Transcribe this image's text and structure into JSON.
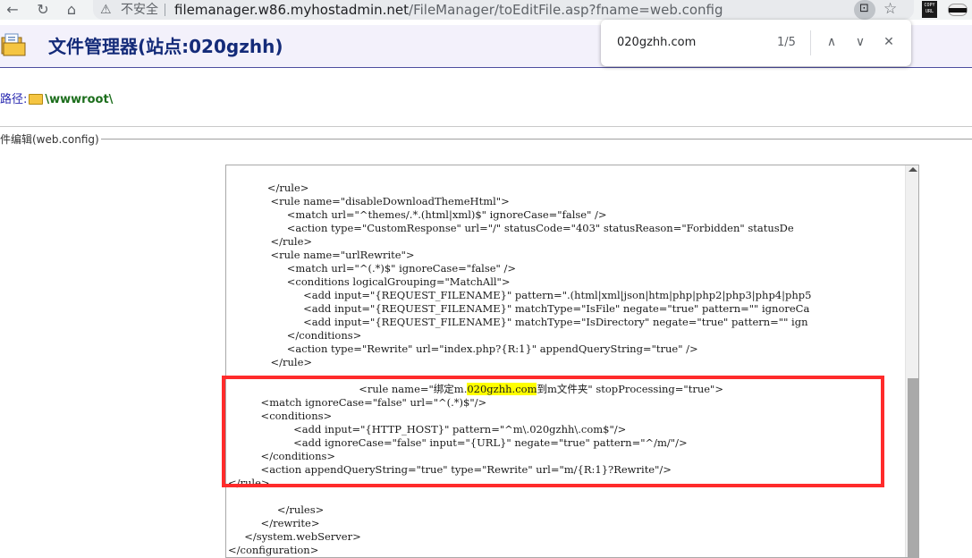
{
  "browser": {
    "back_icon": "arrow-left",
    "forward_icon": "arrow-right",
    "reload_icon": "reload",
    "home_icon": "home",
    "security_label": "不安全",
    "url_host": "filemanager.w86.myhostadmin.net",
    "url_path": "/FileManager/toEditFile.asp?fname=web.config",
    "extensions": [
      "copy-url",
      "mask"
    ]
  },
  "header": {
    "title": "文件管理器(站点:020gzhh)"
  },
  "find": {
    "query": "020gzhh.com",
    "count": "1/5"
  },
  "path": {
    "label": "路径:",
    "value": "\\wwwroot\\"
  },
  "fieldset": {
    "legend": "件编辑(web.config)"
  },
  "editor": {
    "scroll_position": 0.55,
    "lines": [
      "            </rule>",
      "             <rule name=\"disableDownloadThemeHtml\">",
      "                  <match url=\"^themes/.*.(html|xml)$\" ignoreCase=\"false\" />",
      "                  <action type=\"CustomResponse\" url=\"/\" statusCode=\"403\" statusReason=\"Forbidden\" statusDe",
      "             </rule>",
      "             <rule name=\"urlRewrite\">",
      "                  <match url=\"^(.*)$\" ignoreCase=\"false\" />",
      "                  <conditions logicalGrouping=\"MatchAll\">",
      "                       <add input=\"{REQUEST_FILENAME}\" pattern=\".(html|xml|json|htm|php|php2|php3|php4|php5",
      "                       <add input=\"{REQUEST_FILENAME}\" matchType=\"IsFile\" negate=\"true\" pattern=\"\" ignoreCa",
      "                       <add input=\"{REQUEST_FILENAME}\" matchType=\"IsDirectory\" negate=\"true\" pattern=\"\" ign",
      "                  </conditions>",
      "                  <action type=\"Rewrite\" url=\"index.php?{R:1}\" appendQueryString=\"true\" />",
      "             </rule>",
      "",
      "                                        <rule name=\"绑定m.",
      "          <match ignoreCase=\"false\" url=\"^(.*)$\"/>",
      "          <conditions>",
      "                    <add input=\"{HTTP_HOST}\" pattern=\"^m\\.020gzhh\\.com$\"/>",
      "                    <add ignoreCase=\"false\" input=\"{URL}\" negate=\"true\" pattern=\"^/m/\"/>",
      "          </conditions>",
      "          <action appendQueryString=\"true\" type=\"Rewrite\" url=\"m/{R:1}?Rewrite\"/>",
      "</rule>",
      "",
      "               </rules>",
      "          </rewrite>",
      "     </system.webServer>",
      "</configuration>"
    ],
    "rule_line_highlight": "020gzhh.com",
    "rule_line_tail": "到m文件夹\" stopProcessing=\"true\">"
  },
  "colors": {
    "title": "#142b79",
    "header_bg": "#f3f1fb",
    "find_highlight": "#ffff00",
    "annotation_box": "#ff2b2b"
  }
}
